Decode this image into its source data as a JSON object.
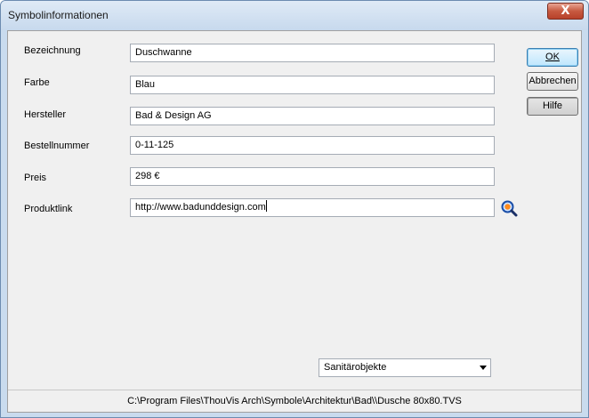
{
  "window": {
    "title": "Symbolinformationen",
    "close_label": "X"
  },
  "fields": [
    {
      "label": "Bezeichnung",
      "value": "Duschwanne"
    },
    {
      "label": "Farbe",
      "value": "Blau"
    },
    {
      "label": "Hersteller",
      "value": "Bad & Design AG"
    },
    {
      "label": "Bestellnummer",
      "value": "0-11-125"
    },
    {
      "label": "Preis",
      "value": "298 €"
    },
    {
      "label": "Produktlink",
      "value": "http://www.badunddesign.com"
    }
  ],
  "buttons": {
    "ok": "OK",
    "cancel": "Abbrechen",
    "help": "Hilfe"
  },
  "link_button_icon": "magnifier-link-icon",
  "category": {
    "selected": "Sanitärobjekte"
  },
  "status": {
    "path": "C:\\Program Files\\ThouVis Arch\\Symbole\\Architektur\\Bad\\\\Dusche 80x80.TVS"
  }
}
